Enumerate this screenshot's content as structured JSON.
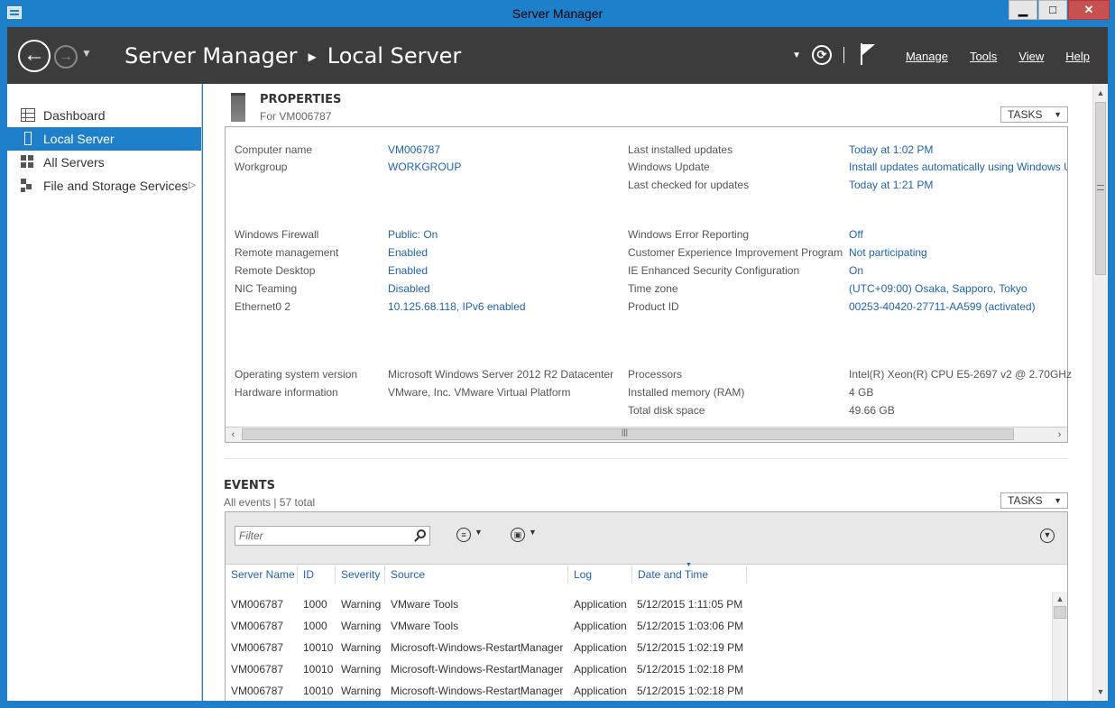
{
  "window": {
    "title": "Server Manager",
    "min_label": "▁",
    "max_label": "□",
    "close_label": "✕"
  },
  "header": {
    "back_label": "←",
    "forward_label": "→",
    "nav_dropdown": "▼",
    "breadcrumb_root": "Server Manager",
    "breadcrumb_sep": "▶",
    "breadcrumb_current": "Local Server",
    "refresh_dropdown": "▼",
    "refresh_label": "⟳",
    "menu": [
      "Manage",
      "Tools",
      "View",
      "Help"
    ]
  },
  "sidebar": {
    "items": [
      {
        "label": "Dashboard",
        "icon": "dashboard-icon",
        "active": false
      },
      {
        "label": "Local Server",
        "icon": "local-server-icon",
        "active": true
      },
      {
        "label": "All Servers",
        "icon": "all-servers-icon",
        "active": false
      },
      {
        "label": "File and Storage Services",
        "icon": "file-storage-icon",
        "active": false,
        "arrow": "▷"
      }
    ]
  },
  "properties": {
    "title": "PROPERTIES",
    "subtitle": "For VM006787",
    "tasks_label": "TASKS",
    "left": [
      {
        "label": "Computer name",
        "value": "VM006787",
        "link": true
      },
      {
        "label": "Workgroup",
        "value": "WORKGROUP",
        "link": true
      },
      {
        "label": "Windows Firewall",
        "value": "Public: On",
        "link": true
      },
      {
        "label": "Remote management",
        "value": "Enabled",
        "link": true
      },
      {
        "label": "Remote Desktop",
        "value": "Enabled",
        "link": true
      },
      {
        "label": "NIC Teaming",
        "value": "Disabled",
        "link": true
      },
      {
        "label": "Ethernet0 2",
        "value": "10.125.68.118, IPv6 enabled",
        "link": true
      },
      {
        "label": "Operating system version",
        "value": "Microsoft Windows Server 2012 R2 Datacenter",
        "link": false
      },
      {
        "label": "Hardware information",
        "value": "VMware, Inc. VMware Virtual Platform",
        "link": false
      }
    ],
    "right": [
      {
        "label": "Last installed updates",
        "value": "Today at 1:02 PM",
        "link": true
      },
      {
        "label": "Windows Update",
        "value": "Install updates automatically using Windows U",
        "link": true
      },
      {
        "label": "Last checked for updates",
        "value": "Today at 1:21 PM",
        "link": true
      },
      {
        "label": "Windows Error Reporting",
        "value": "Off",
        "link": true
      },
      {
        "label": "Customer Experience Improvement Program",
        "value": "Not participating",
        "link": true
      },
      {
        "label": "IE Enhanced Security Configuration",
        "value": "On",
        "link": true
      },
      {
        "label": "Time zone",
        "value": "(UTC+09:00) Osaka, Sapporo, Tokyo",
        "link": true
      },
      {
        "label": "Product ID",
        "value": "00253-40420-27711-AA599 (activated)",
        "link": true
      },
      {
        "label": "Processors",
        "value": "Intel(R) Xeon(R) CPU E5-2697 v2 @ 2.70GHz",
        "link": false
      },
      {
        "label": "Installed memory (RAM)",
        "value": "4 GB",
        "link": false
      },
      {
        "label": "Total disk space",
        "value": "49.66 GB",
        "link": false
      }
    ]
  },
  "events": {
    "title": "EVENTS",
    "subtitle": "All events | 57 total",
    "tasks_label": "TASKS",
    "filter_placeholder": "Filter",
    "columns": [
      "Server Name",
      "ID",
      "Severity",
      "Source",
      "Log",
      "Date and Time"
    ],
    "rows": [
      [
        "VM006787",
        "1000",
        "Warning",
        "VMware Tools",
        "Application",
        "5/12/2015 1:11:05 PM"
      ],
      [
        "VM006787",
        "1000",
        "Warning",
        "VMware Tools",
        "Application",
        "5/12/2015 1:03:06 PM"
      ],
      [
        "VM006787",
        "10010",
        "Warning",
        "Microsoft-Windows-RestartManager",
        "Application",
        "5/12/2015 1:02:19 PM"
      ],
      [
        "VM006787",
        "10010",
        "Warning",
        "Microsoft-Windows-RestartManager",
        "Application",
        "5/12/2015 1:02:18 PM"
      ],
      [
        "VM006787",
        "10010",
        "Warning",
        "Microsoft-Windows-RestartManager",
        "Application",
        "5/12/2015 1:02:18 PM"
      ]
    ]
  },
  "colors": {
    "accent": "#1e7fcb",
    "header_bg": "#3c3c3c",
    "link": "#1e63b0"
  }
}
